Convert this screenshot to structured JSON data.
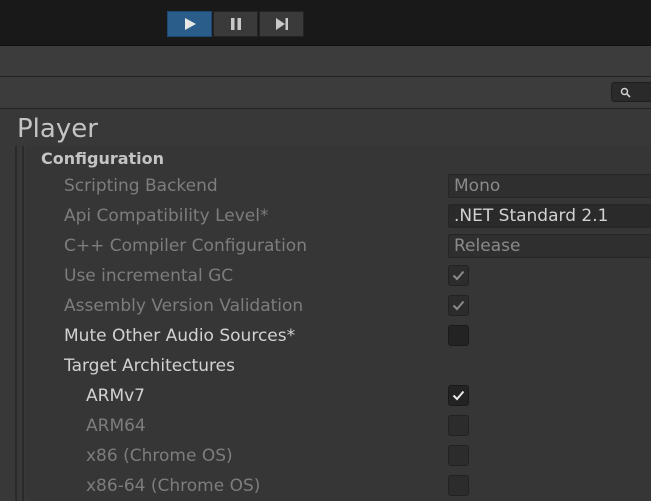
{
  "toolbar": {
    "buttons": [
      {
        "name": "play",
        "icon": "play-icon",
        "active": true
      },
      {
        "name": "pause",
        "icon": "pause-icon",
        "active": false
      },
      {
        "name": "step",
        "icon": "step-icon",
        "active": false
      }
    ]
  },
  "search": {
    "icon": "search-icon"
  },
  "inspector": {
    "title": "Player",
    "section": "Configuration",
    "rows": [
      {
        "label": "Scripting Backend",
        "value": "Mono"
      },
      {
        "label": "Api Compatibility Level*",
        "value": ".NET Standard 2.1"
      },
      {
        "label": "C++ Compiler Configuration",
        "value": "Release"
      },
      {
        "label": "Use incremental GC",
        "checked": true
      },
      {
        "label": "Assembly Version Validation",
        "checked": true
      },
      {
        "label": "Mute Other Audio Sources*",
        "checked": false
      },
      {
        "label": "Target Architectures"
      },
      {
        "label": "ARMv7",
        "checked": true
      },
      {
        "label": "ARM64",
        "checked": false
      },
      {
        "label": "x86 (Chrome OS)",
        "checked": false
      },
      {
        "label": "x86-64 (Chrome OS)",
        "checked": false
      }
    ]
  },
  "colors": {
    "accent": "#2b5d8a",
    "background": "#383838",
    "toolbar": "#191919"
  }
}
